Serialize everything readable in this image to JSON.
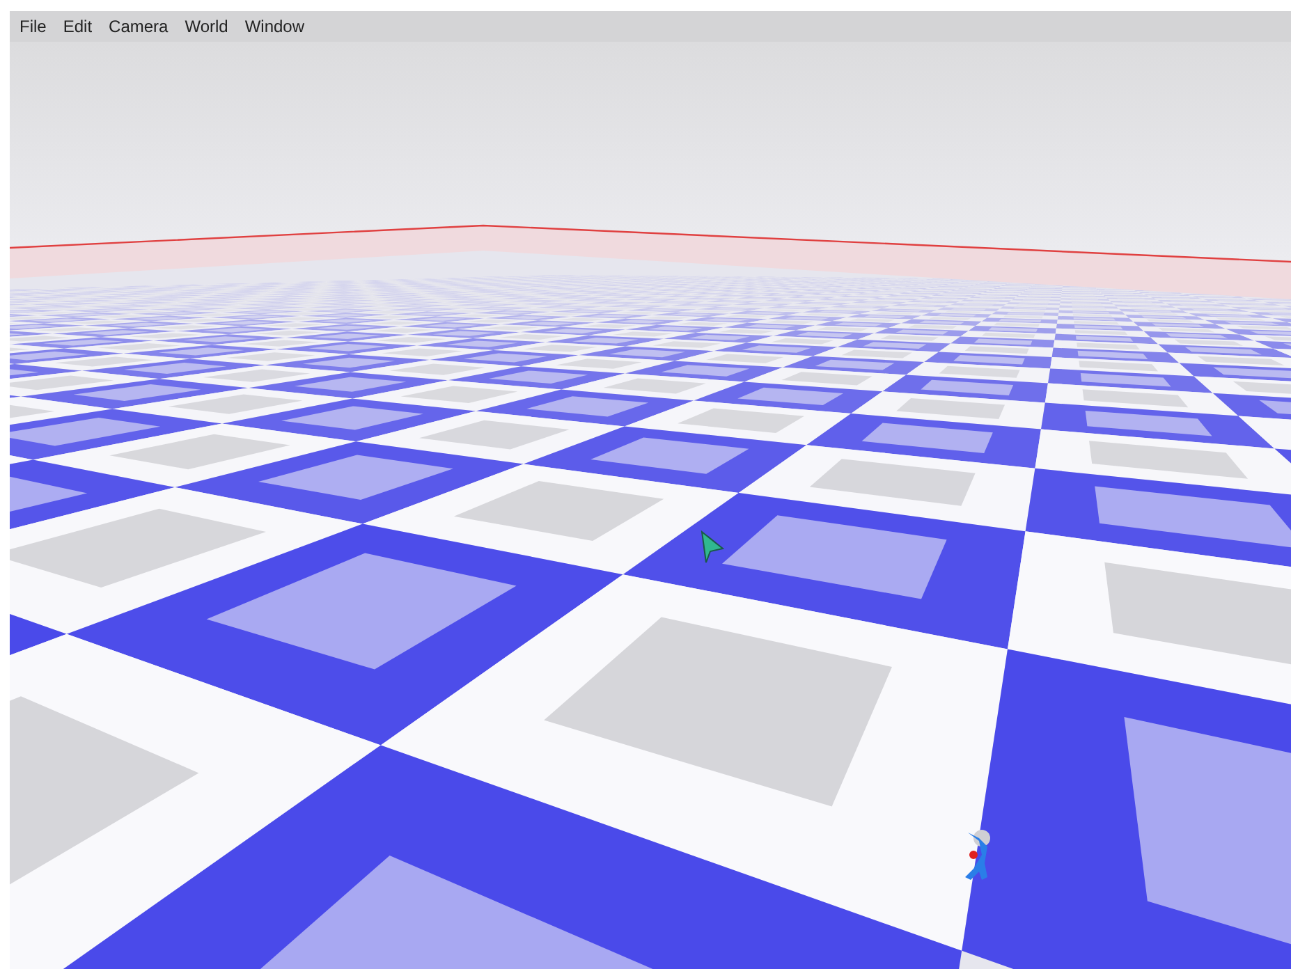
{
  "menu_bar": {
    "items": [
      "File",
      "Edit",
      "Camera",
      "World",
      "Window"
    ]
  }
}
